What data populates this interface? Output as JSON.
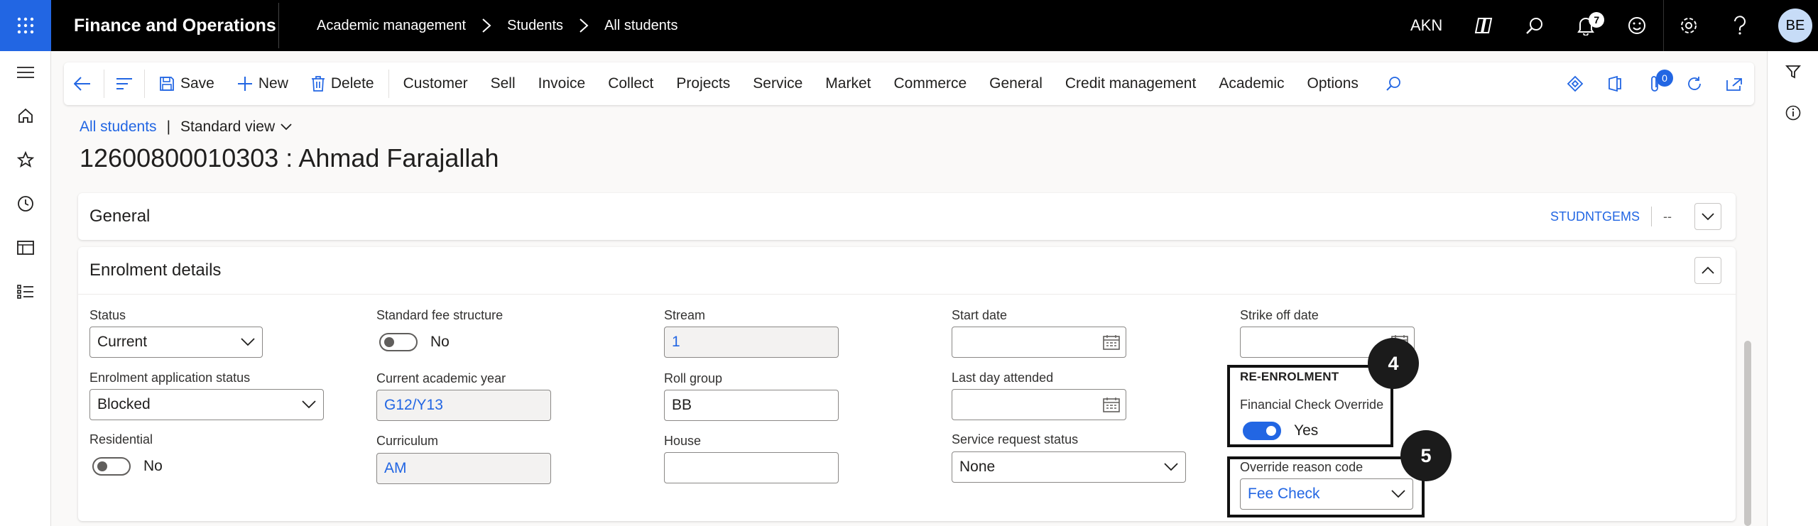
{
  "topbar": {
    "app_title": "Finance and Operations",
    "breadcrumb": [
      "Academic management",
      "Students",
      "All students"
    ],
    "company": "AKN",
    "notification_count": "7",
    "user_initials": "BE"
  },
  "leftnav": {
    "items": [
      "hamburger-icon",
      "home-icon",
      "star-icon",
      "clock-icon",
      "workspace-icon",
      "modules-icon"
    ]
  },
  "actionpane": {
    "save": "Save",
    "new": "New",
    "delete": "Delete",
    "tabs": [
      "Customer",
      "Sell",
      "Invoice",
      "Collect",
      "Projects",
      "Service",
      "Market",
      "Commerce",
      "General",
      "Credit management",
      "Academic",
      "Options"
    ],
    "attachments_count": "0"
  },
  "page": {
    "link": "All students",
    "view": "Standard view",
    "record_title": "12600800010303 : Ahmad Farajallah"
  },
  "general_tab": {
    "title": "General",
    "summary_1": "STUDNTGEMS",
    "summary_2": "--"
  },
  "enrolment_tab": {
    "title": "Enrolment details",
    "status": {
      "label": "Status",
      "value": "Current"
    },
    "enrolment_application_status": {
      "label": "Enrolment application status",
      "value": "Blocked"
    },
    "residential": {
      "label": "Residential",
      "value": "No"
    },
    "standard_fee_structure": {
      "label": "Standard fee structure",
      "value": "No"
    },
    "current_academic_year": {
      "label": "Current academic year",
      "value": "G12/Y13"
    },
    "curriculum": {
      "label": "Curriculum",
      "value": "AM"
    },
    "stream": {
      "label": "Stream",
      "value": "1"
    },
    "roll_group": {
      "label": "Roll group",
      "value": "BB"
    },
    "house": {
      "label": "House",
      "value": ""
    },
    "start_date": {
      "label": "Start date",
      "value": ""
    },
    "last_day_attended": {
      "label": "Last day attended",
      "value": ""
    },
    "service_request_status": {
      "label": "Service request status",
      "value": "None"
    },
    "strike_off_date": {
      "label": "Strike off date",
      "value": ""
    },
    "re_enrolment": {
      "heading": "RE-ENROLMENT",
      "financial_check_override": {
        "label": "Financial Check Override",
        "value": "Yes"
      },
      "override_reason_code": {
        "label": "Override reason code",
        "value": "Fee Check"
      }
    }
  },
  "steps": {
    "step4": "4",
    "step5": "5"
  },
  "rightpane": {
    "items": [
      "filter-icon",
      "info-icon"
    ]
  }
}
